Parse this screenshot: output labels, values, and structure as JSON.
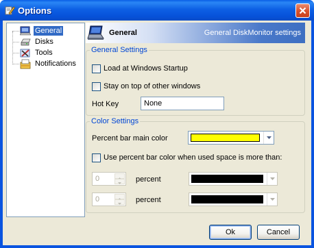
{
  "window": {
    "title": "Options",
    "icon": "pencil-options-icon",
    "close_icon": "close-x-icon"
  },
  "tree": {
    "items": [
      {
        "label": "General",
        "icon": "monitor-icon",
        "selected": true
      },
      {
        "label": "Disks",
        "icon": "disk-drive-icon",
        "selected": false
      },
      {
        "label": "Tools",
        "icon": "tools-icon",
        "selected": false
      },
      {
        "label": "Notifications",
        "icon": "notification-tray-icon",
        "selected": false
      }
    ]
  },
  "header": {
    "title": "General",
    "subtitle": "General DiskMonitor settings",
    "icon": "laptop-icon"
  },
  "general_settings": {
    "legend": "General Settings",
    "load_startup": {
      "label": "Load at Windows Startup",
      "checked": false
    },
    "stay_on_top": {
      "label": "Stay on top of other windows",
      "checked": false
    },
    "hotkey": {
      "label": "Hot Key",
      "value": "None"
    }
  },
  "color_settings": {
    "legend": "Color Settings",
    "main_color": {
      "label": "Percent bar main color",
      "color": "#ffff00"
    },
    "use_percent": {
      "label": "Use percent bar  color when used space is more than:",
      "checked": false
    },
    "rows": [
      {
        "value": "0",
        "label": "percent",
        "color": "#000000"
      },
      {
        "value": "0",
        "label": "percent",
        "color": "#000000"
      }
    ]
  },
  "buttons": {
    "ok": "Ok",
    "cancel": "Cancel"
  },
  "colors": {
    "titlebar": "#0a54e0",
    "dialog_bg": "#ece9d8",
    "legend": "#0046d5",
    "selection": "#316ac5"
  }
}
